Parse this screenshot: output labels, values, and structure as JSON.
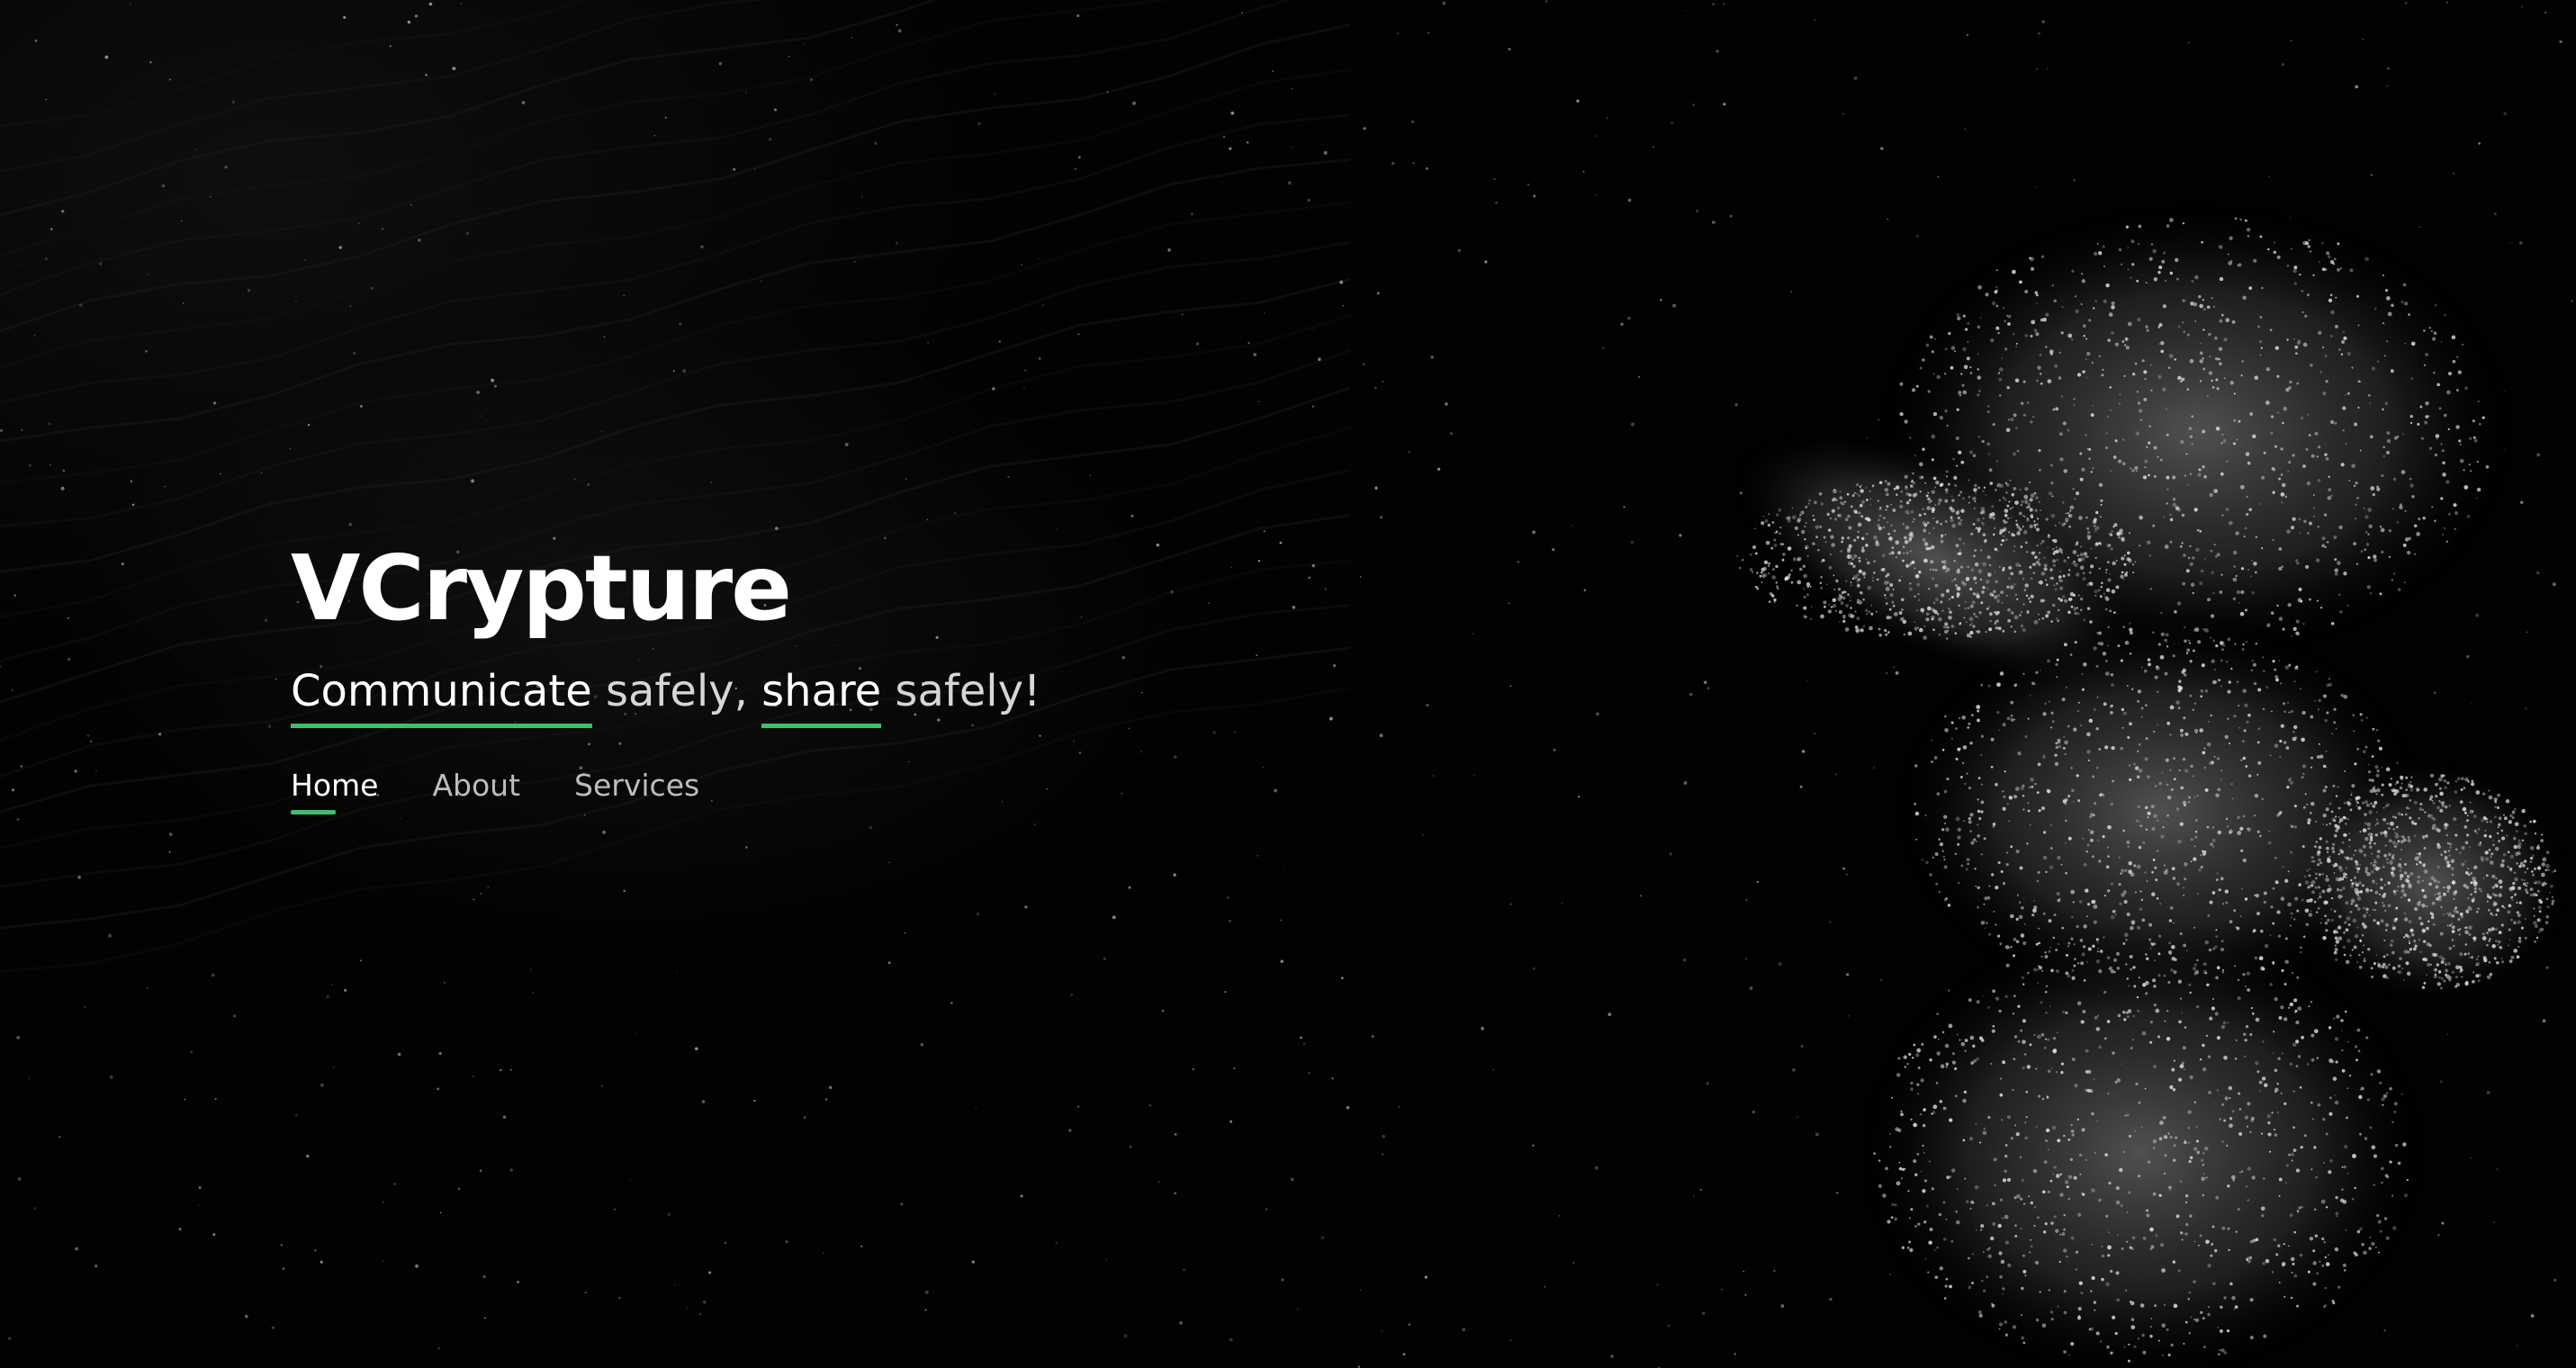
{
  "hero": {
    "title": "VCrypture",
    "tagline": {
      "word1": "Communicate",
      "word2": " safely, ",
      "word3": "share",
      "word4": " safely!"
    },
    "accent_color": "#3fbf6a"
  },
  "nav": {
    "items": [
      {
        "label": "Home",
        "active": true
      },
      {
        "label": "About",
        "active": false
      },
      {
        "label": "Services",
        "active": false
      }
    ]
  },
  "background": {
    "image": "particle-figure-illustration"
  }
}
